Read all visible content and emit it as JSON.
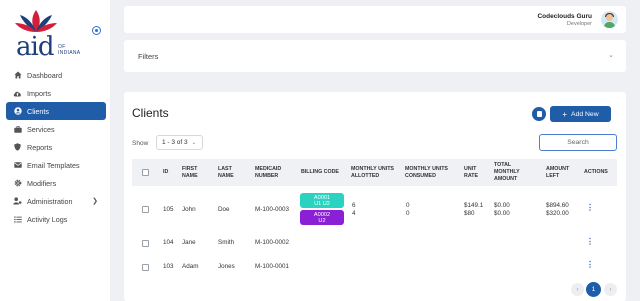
{
  "brand": {
    "logo_text": "aid",
    "logo_sub_line1": "OF",
    "logo_sub_line2": "INDIANA"
  },
  "sidebar": {
    "items": [
      {
        "label": "Dashboard",
        "icon": "home-icon"
      },
      {
        "label": "Imports",
        "icon": "cloud-upload-icon"
      },
      {
        "label": "Clients",
        "icon": "user-circle-icon",
        "active": true
      },
      {
        "label": "Services",
        "icon": "briefcase-icon"
      },
      {
        "label": "Reports",
        "icon": "shield-icon"
      },
      {
        "label": "Email Templates",
        "icon": "envelope-icon"
      },
      {
        "label": "Modifiers",
        "icon": "gear-icon"
      },
      {
        "label": "Administration",
        "icon": "user-cog-icon",
        "has_submenu": true
      },
      {
        "label": "Activity Logs",
        "icon": "list-icon"
      }
    ]
  },
  "header": {
    "user_name": "Codeclouds Guru",
    "user_role": "Developer"
  },
  "filters": {
    "title": "Filters"
  },
  "clients": {
    "title": "Clients",
    "add_label": "Add New",
    "show_label": "Show",
    "show_value": "1 - 3 of 3",
    "search_placeholder": "Search",
    "columns": {
      "id": "ID",
      "first_name_1": "FIRST",
      "first_name_2": "NAME",
      "last_name_1": "LAST",
      "last_name_2": "NAME",
      "medicaid_1": "MEDICAID",
      "medicaid_2": "NUMBER",
      "billing": "BILLING CODE",
      "allotted_1": "MONTHLY UNITS",
      "allotted_2": "ALLOTTED",
      "consumed_1": "MONTHLY UNITS",
      "consumed_2": "CONSUMED",
      "rate_1": "UNIT",
      "rate_2": "RATE",
      "total_1": "TOTAL",
      "total_2": "MONTHLY",
      "total_3": "AMOUNT",
      "left_1": "AMOUNT",
      "left_2": "LEFT",
      "actions": "ACTIONS"
    },
    "rows": [
      {
        "id": "105",
        "first": "John",
        "last": "Doe",
        "medicaid": "M-100-0003",
        "billing": [
          {
            "line1": "A0001",
            "line2": "U1 U2",
            "color": "#2ad3c0"
          },
          {
            "line1": "A0002",
            "line2": "U2",
            "color": "#8b1fd6"
          }
        ],
        "allotted": [
          "6",
          "4"
        ],
        "consumed": [
          "0",
          "0"
        ],
        "rate": [
          "$149.1",
          "$80"
        ],
        "total": [
          "$0.00",
          "$0.00"
        ],
        "left": [
          "$894.60",
          "$320.00"
        ]
      },
      {
        "id": "104",
        "first": "Jane",
        "last": "Smith",
        "medicaid": "M-100-0002"
      },
      {
        "id": "103",
        "first": "Adam",
        "last": "Jones",
        "medicaid": "M-100-0001"
      }
    ],
    "pagination": {
      "prev": "‹",
      "current": "1",
      "next": "›"
    }
  },
  "colors": {
    "primary": "#1f5da8",
    "badge_teal": "#2ad3c0",
    "badge_purple": "#8b1fd6"
  }
}
